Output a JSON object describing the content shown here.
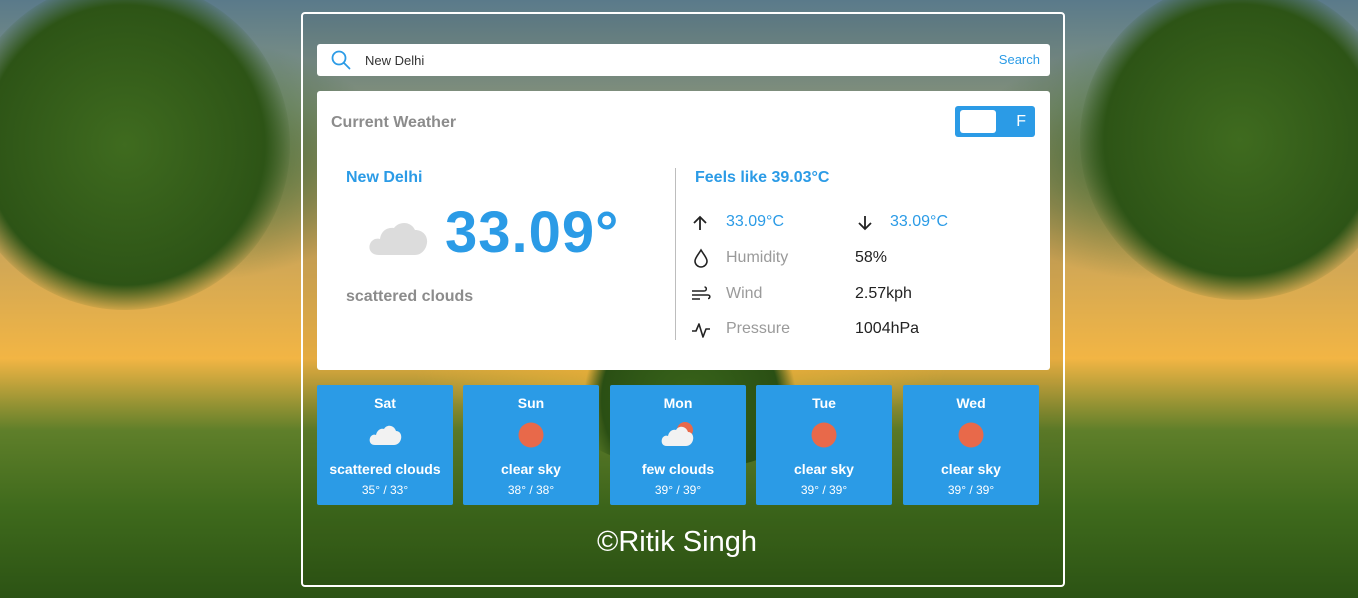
{
  "search": {
    "value": "New Delhi",
    "button_label": "Search"
  },
  "current": {
    "title": "Current Weather",
    "unit_toggle_label": "F",
    "city": "New Delhi",
    "icon": "cloud-icon",
    "temperature": "33.09°",
    "description": "scattered clouds",
    "feels_like": "Feels like 39.03°C",
    "temp_max": "33.09°C",
    "temp_min": "33.09°C",
    "humidity_label": "Humidity",
    "humidity_value": "58%",
    "wind_label": "Wind",
    "wind_value": "2.57kph",
    "pressure_label": "Pressure",
    "pressure_value": "1004hPa"
  },
  "forecast": [
    {
      "day": "Sat",
      "icon": "cloud-icon",
      "description": "scattered clouds",
      "temps": "35° / 33°"
    },
    {
      "day": "Sun",
      "icon": "sun-icon",
      "description": "clear sky",
      "temps": "38° / 38°"
    },
    {
      "day": "Mon",
      "icon": "sun-cloud-icon",
      "description": "few clouds",
      "temps": "39° / 39°"
    },
    {
      "day": "Tue",
      "icon": "sun-icon",
      "description": "clear sky",
      "temps": "39° / 39°"
    },
    {
      "day": "Wed",
      "icon": "sun-icon",
      "description": "clear sky",
      "temps": "39° / 39°"
    }
  ],
  "footer": {
    "text": "©Ritik Singh"
  },
  "colors": {
    "accent": "#2b9be6",
    "sun": "#e8694a",
    "muted": "#8c8c8c"
  }
}
